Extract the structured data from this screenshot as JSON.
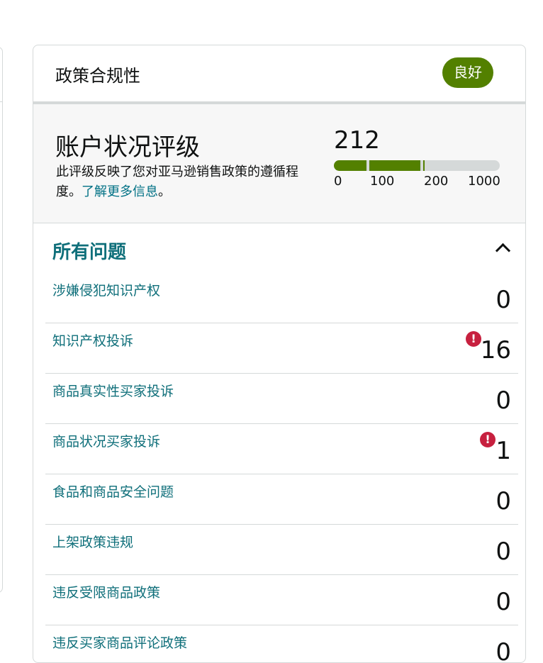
{
  "card": {
    "title": "政策合规性",
    "badge": "良好"
  },
  "health": {
    "title": "账户状况评级",
    "desc": "此评级反映了您对亚马逊销售政策的遵循程度。",
    "link": "了解更多信息",
    "suffix": "。",
    "score": "212",
    "score_fraction_of_scale": 0.53,
    "ticks": [
      "0",
      "100",
      "200",
      "1000"
    ]
  },
  "issues": {
    "title": "所有问题",
    "rows": [
      {
        "label": "涉嫌侵犯知识产权",
        "count": "0",
        "alert": false
      },
      {
        "label": "知识产权投诉",
        "count": "16",
        "alert": true
      },
      {
        "label": "商品真实性买家投诉",
        "count": "0",
        "alert": false
      },
      {
        "label": "商品状况买家投诉",
        "count": "1",
        "alert": true
      },
      {
        "label": "食品和商品安全问题",
        "count": "0",
        "alert": false
      },
      {
        "label": "上架政策违规",
        "count": "0",
        "alert": false
      },
      {
        "label": "违反受限商品政策",
        "count": "0",
        "alert": false
      },
      {
        "label": "违反买家商品评论政策",
        "count": "0",
        "alert": false
      }
    ]
  },
  "colors": {
    "accent": "#538000",
    "link": "#0f6f7a",
    "alert": "#c7203f"
  }
}
